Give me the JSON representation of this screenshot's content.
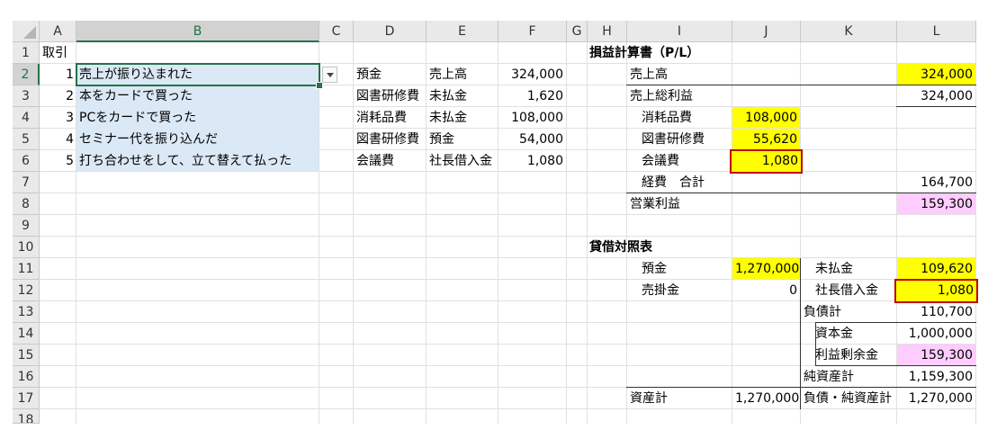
{
  "columns": [
    "A",
    "B",
    "C",
    "D",
    "E",
    "F",
    "G",
    "H",
    "I",
    "J",
    "K",
    "L"
  ],
  "rows": [
    "1",
    "2",
    "3",
    "4",
    "5",
    "6",
    "7",
    "8",
    "9",
    "10",
    "11",
    "12",
    "13",
    "14",
    "15",
    "16",
    "17",
    "18"
  ],
  "selected_column": "B",
  "selected_row": "2",
  "a1": "取引",
  "transactions": [
    {
      "num": "1",
      "desc": "売上が振り込まれた",
      "debit": "預金",
      "credit": "売上高",
      "amount": "324,000"
    },
    {
      "num": "2",
      "desc": "本をカードで買った",
      "debit": "図書研修費",
      "credit": "未払金",
      "amount": "1,620"
    },
    {
      "num": "3",
      "desc": "PCをカードで買った",
      "debit": "消耗品費",
      "credit": "未払金",
      "amount": "108,000"
    },
    {
      "num": "4",
      "desc": "セミナー代を振り込んだ",
      "debit": "図書研修費",
      "credit": "預金",
      "amount": "54,000"
    },
    {
      "num": "5",
      "desc": "打ち合わせをして、立て替えて払った",
      "debit": "会議費",
      "credit": "社長借入金",
      "amount": "1,080"
    }
  ],
  "pl": {
    "title": "損益計算書（P/L）",
    "sales_label": "売上高",
    "sales_value": "324,000",
    "gross_label": "売上総利益",
    "gross_value": "324,000",
    "exp1_label": "消耗品費",
    "exp1_value": "108,000",
    "exp2_label": "図書研修費",
    "exp2_value": "55,620",
    "exp3_label": "会議費",
    "exp3_value": "1,080",
    "exp_total_label": "経費　合計",
    "exp_total_value": "164,700",
    "op_label": "営業利益",
    "op_value": "159,300"
  },
  "bs": {
    "title": "貸借対照表",
    "cash_label": "預金",
    "cash_value": "1,270,000",
    "ar_label": "売掛金",
    "ar_value": "0",
    "ap_label": "未払金",
    "ap_value": "109,620",
    "loan_label": "社長借入金",
    "loan_value": "1,080",
    "liab_total_label": "負債計",
    "liab_total_value": "110,700",
    "capital_label": "資本金",
    "capital_value": "1,000,000",
    "retained_label": "利益剰余金",
    "retained_value": "159,300",
    "net_total_label": "純資産計",
    "net_total_value": "1,159,300",
    "assets_label": "資産計",
    "assets_value": "1,270,000",
    "le_label": "負債・純資産計",
    "le_value": "1,270,000"
  }
}
